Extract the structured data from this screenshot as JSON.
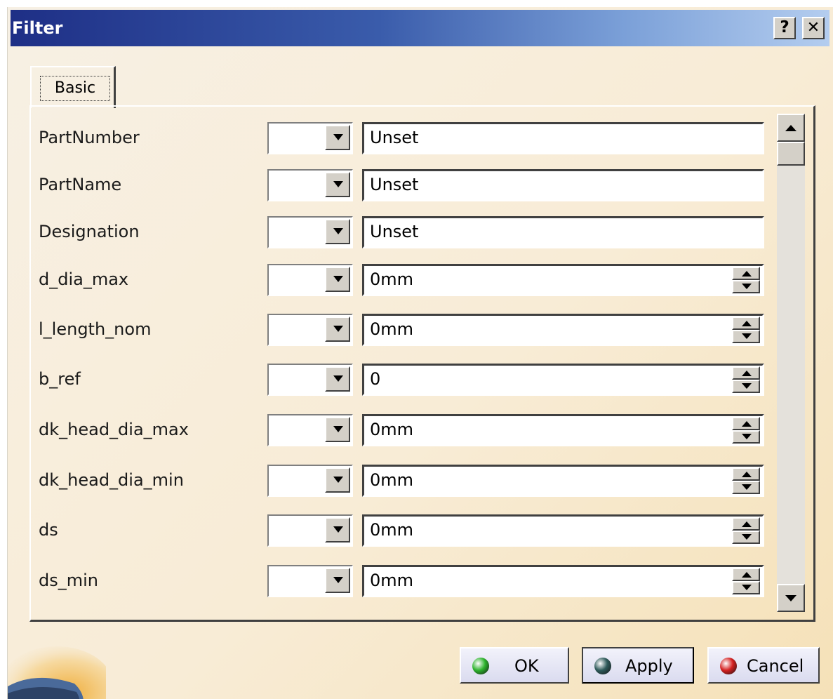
{
  "window": {
    "title": "Filter",
    "help_glyph": "?",
    "close_glyph": "✕"
  },
  "tabs": [
    {
      "label": "Basic",
      "selected": true
    }
  ],
  "rows": [
    {
      "label": "PartNumber",
      "value": "Unset",
      "spinner": false
    },
    {
      "label": "PartName",
      "value": "Unset",
      "spinner": false
    },
    {
      "label": "Designation",
      "value": "Unset",
      "spinner": false
    },
    {
      "label": "d_dia_max",
      "value": "0mm",
      "spinner": true
    },
    {
      "label": "l_length_nom",
      "value": "0mm",
      "spinner": true
    },
    {
      "label": "b_ref",
      "value": "0",
      "spinner": true
    },
    {
      "label": "dk_head_dia_max",
      "value": "0mm",
      "spinner": true
    },
    {
      "label": "dk_head_dia_min",
      "value": "0mm",
      "spinner": true
    },
    {
      "label": "ds",
      "value": "0mm",
      "spinner": true
    },
    {
      "label": "ds_min",
      "value": "0mm",
      "spinner": true
    }
  ],
  "buttons": {
    "ok": "OK",
    "apply": "Apply",
    "cancel": "Cancel"
  },
  "colors": {
    "ok_icon": "#2db32d",
    "apply_icon": "#2e5a5a",
    "cancel_icon": "#d42020",
    "title_bar_start": "#1e2f86",
    "title_bar_end": "#b4cdef"
  }
}
